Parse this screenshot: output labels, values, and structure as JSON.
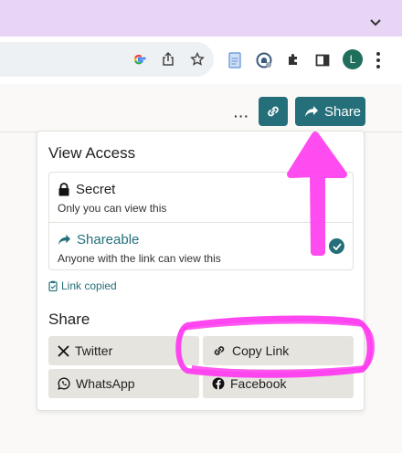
{
  "browser": {
    "profile_initial": "L",
    "icons": [
      "google-lens-icon",
      "share-page-icon",
      "bookmark-star-icon",
      "docs-extension-icon",
      "password-extension-icon",
      "extensions-puzzle-icon",
      "side-panel-icon"
    ]
  },
  "header": {
    "more_label": "···",
    "share_label": "Share"
  },
  "panel": {
    "view_access_heading": "View Access",
    "options": [
      {
        "title": "Secret",
        "description": "Only you can view this",
        "icon": "lock-icon",
        "selected": false
      },
      {
        "title": "Shareable",
        "description": "Anyone with the link can view this",
        "icon": "share-arrow-icon",
        "selected": true
      }
    ],
    "link_copied": "Link copied",
    "share_heading": "Share",
    "share_buttons": [
      {
        "label": "Twitter",
        "icon": "x-logo-icon"
      },
      {
        "label": "Copy Link",
        "icon": "link-icon"
      },
      {
        "label": "WhatsApp",
        "icon": "whatsapp-icon"
      },
      {
        "label": "Facebook",
        "icon": "facebook-icon"
      }
    ]
  },
  "colors": {
    "accent": "#246f7a",
    "annotation": "#ff3df0",
    "tabstrip": "#e8d5f6"
  }
}
